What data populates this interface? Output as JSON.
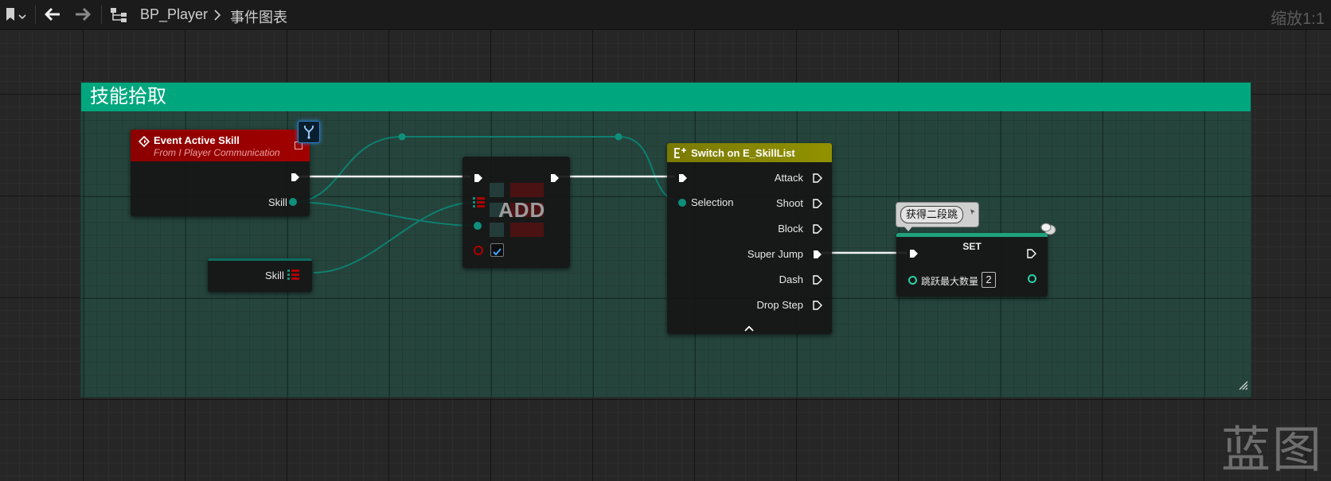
{
  "toolbar": {
    "breadcrumb_asset": "BP_Player",
    "breadcrumb_graph": "事件图表",
    "zoom": "缩放1:1"
  },
  "comment": {
    "title": "技能拾取"
  },
  "event_node": {
    "title": "Event Active Skill",
    "subtitle": "From I Player Communication",
    "output_pin": "Skill"
  },
  "variable_node": {
    "label": "Skill"
  },
  "add_node": {
    "label": "ADD"
  },
  "switch_node": {
    "title": "Switch on E_SkillList",
    "input_pin": "Selection",
    "outputs": [
      "Attack",
      "Shoot",
      "Block",
      "Super Jump",
      "Dash",
      "Drop Step"
    ]
  },
  "set_node": {
    "title": "SET",
    "comment_bubble": "获得二段跳",
    "variable": "跳跃最大数量",
    "value": "2"
  },
  "watermark": "蓝图",
  "colors": {
    "comment_header": "#00a77e",
    "event_header": "#a10000",
    "switch_header": "#919100",
    "enum_wire": "#0e7f70",
    "exec_wire": "#ffffff"
  }
}
